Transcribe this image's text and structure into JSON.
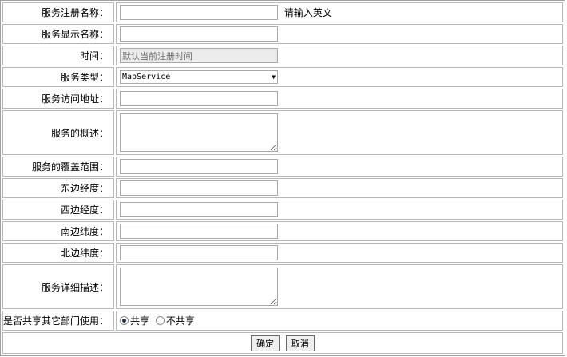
{
  "fields": {
    "service_reg_name": {
      "label": "服务注册名称：",
      "hint": "请输入英文",
      "value": ""
    },
    "service_display_name": {
      "label": "服务显示名称：",
      "value": ""
    },
    "time": {
      "label": "时间：",
      "value": "默认当前注册时间"
    },
    "service_type": {
      "label": "服务类型：",
      "value": "MapService"
    },
    "service_url": {
      "label": "服务访问地址：",
      "value": ""
    },
    "service_overview": {
      "label": "服务的概述：",
      "value": ""
    },
    "service_coverage": {
      "label": "服务的覆盖范围：",
      "value": ""
    },
    "east_longitude": {
      "label": "东边经度：",
      "value": ""
    },
    "west_longitude": {
      "label": "西边经度：",
      "value": ""
    },
    "south_latitude": {
      "label": "南边纬度：",
      "value": ""
    },
    "north_latitude": {
      "label": "北边纬度：",
      "value": ""
    },
    "service_detail": {
      "label": "服务详细描述：",
      "value": ""
    },
    "share": {
      "label": "是否共享其它部门使用：",
      "options": [
        "共享",
        "不共享"
      ],
      "selected": "共享"
    }
  },
  "buttons": {
    "confirm": "确定",
    "cancel": "取消"
  }
}
